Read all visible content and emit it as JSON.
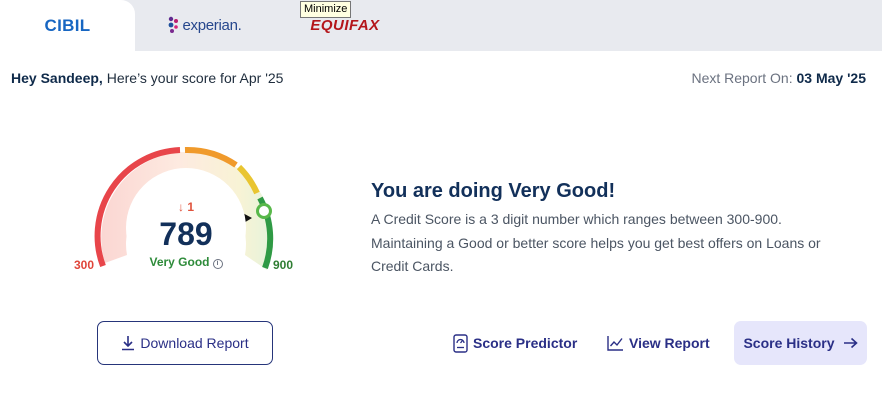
{
  "tabs": {
    "cibil": "CIBIL",
    "experian": "experian.",
    "equifax": "EQUIFAX"
  },
  "tooltip": "Minimize",
  "greeting": {
    "name": "Hey Sandeep,",
    "text": " Here’s your score for Apr '25"
  },
  "next_report": {
    "label": "Next Report On: ",
    "date": "03 May '25"
  },
  "score": {
    "change": "1",
    "value": "789",
    "band": "Very Good",
    "min": "300",
    "max": "900",
    "fraction": 0.815
  },
  "message": {
    "headline": "You are doing Very Good!",
    "description": "A Credit Score is a 3 digit number which ranges between 300-900. Maintaining a Good or better score helps you get best offers on Loans or Credit Cards."
  },
  "actions": {
    "download": "Download Report",
    "predictor": "Score Predictor",
    "view": "View Report",
    "history": "Score History"
  },
  "colors": {
    "accent": "#2a2f86",
    "tab_active": "#1766c2",
    "score_text": "#12305a",
    "good": "#2e8b3a",
    "poor": "#e0453a"
  },
  "icons": {
    "download": "download-icon",
    "predictor": "score-predictor-icon",
    "view": "chart-line-icon",
    "history": "arrow-right-icon",
    "info": "info-icon",
    "trend": "arrow-down-icon",
    "pointer": "gauge-pointer-icon"
  }
}
